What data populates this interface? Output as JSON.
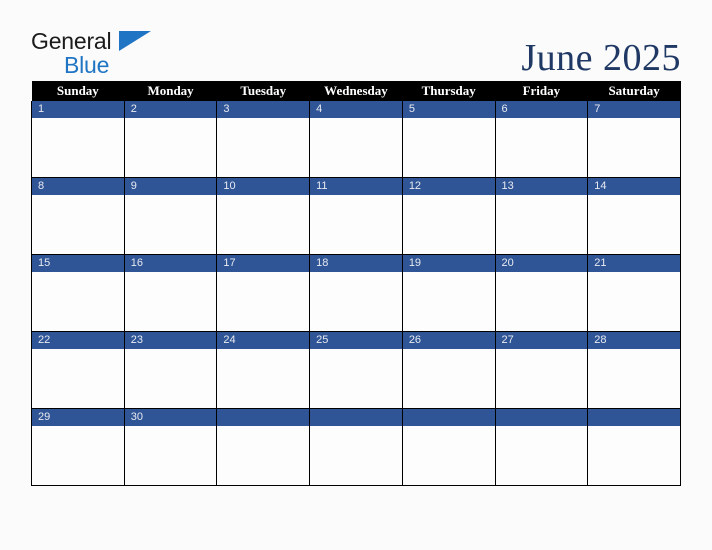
{
  "brand": {
    "logo_text_1": "General",
    "logo_text_2": "Blue",
    "logo_triangle_icon": "triangle-icon",
    "color_dark": "#1b1b1b",
    "color_blue": "#1f75c4"
  },
  "header": {
    "title": "June 2025",
    "title_color": "#1f3864"
  },
  "calendar": {
    "month": "June",
    "year": "2025",
    "header_background": "#000000",
    "header_text_color": "#ffffff",
    "daynum_background": "#2f5597",
    "daynum_text_color": "#e8eaf0",
    "weekdays": [
      "Sunday",
      "Monday",
      "Tuesday",
      "Wednesday",
      "Thursday",
      "Friday",
      "Saturday"
    ],
    "weeks": [
      [
        {
          "date": "1"
        },
        {
          "date": "2"
        },
        {
          "date": "3"
        },
        {
          "date": "4"
        },
        {
          "date": "5"
        },
        {
          "date": "6"
        },
        {
          "date": "7"
        }
      ],
      [
        {
          "date": "8"
        },
        {
          "date": "9"
        },
        {
          "date": "10"
        },
        {
          "date": "11"
        },
        {
          "date": "12"
        },
        {
          "date": "13"
        },
        {
          "date": "14"
        }
      ],
      [
        {
          "date": "15"
        },
        {
          "date": "16"
        },
        {
          "date": "17"
        },
        {
          "date": "18"
        },
        {
          "date": "19"
        },
        {
          "date": "20"
        },
        {
          "date": "21"
        }
      ],
      [
        {
          "date": "22"
        },
        {
          "date": "23"
        },
        {
          "date": "24"
        },
        {
          "date": "25"
        },
        {
          "date": "26"
        },
        {
          "date": "27"
        },
        {
          "date": "28"
        }
      ],
      [
        {
          "date": "29"
        },
        {
          "date": "30"
        },
        {
          "date": ""
        },
        {
          "date": ""
        },
        {
          "date": ""
        },
        {
          "date": ""
        },
        {
          "date": ""
        }
      ]
    ]
  }
}
